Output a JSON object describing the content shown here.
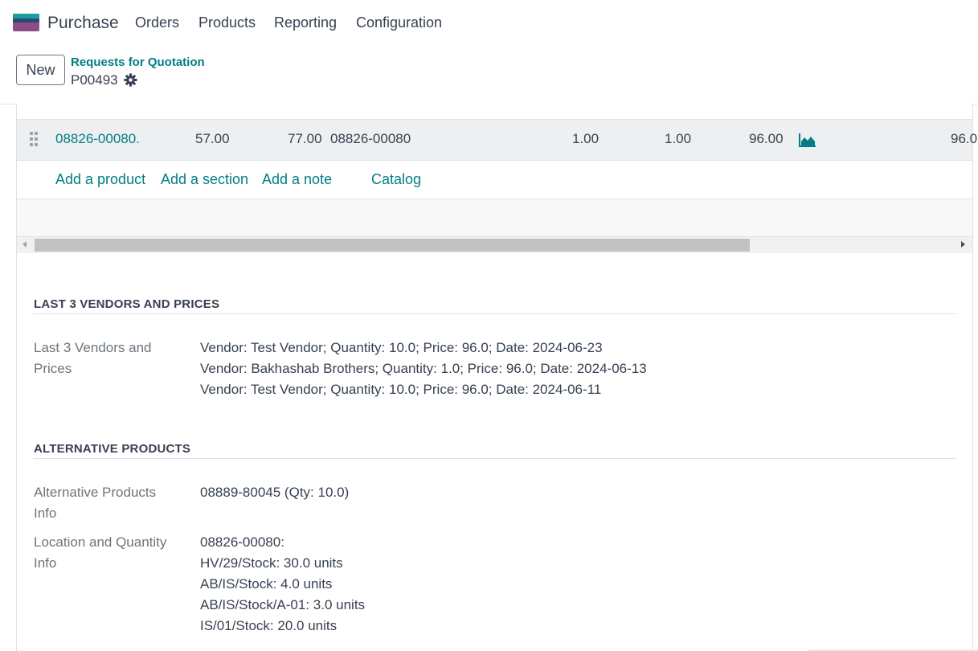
{
  "nav": {
    "app_name": "Purchase",
    "menu": [
      "Orders",
      "Products",
      "Reporting",
      "Configuration"
    ]
  },
  "control_panel": {
    "new_label": "New",
    "breadcrumb_parent": "Requests for Quotation",
    "breadcrumb_current": "P00493"
  },
  "order_line": {
    "product": "08826-00080.",
    "col_a": "57.00",
    "col_b": "77.00",
    "description": "08826-00080",
    "quantity": "1.00",
    "quantity_2": "1.00",
    "unit_price": "96.00",
    "subtotal": "96.0"
  },
  "line_actions": {
    "add_product": "Add a product",
    "add_section": "Add a section",
    "add_note": "Add a note",
    "catalog": "Catalog"
  },
  "vendors_section": {
    "title": "LAST 3 VENDORS AND PRICES",
    "label": "Last 3 Vendors and Prices",
    "lines": [
      "Vendor: Test Vendor; Quantity: 10.0; Price: 96.0; Date: 2024-06-23",
      "Vendor: Bakhashab Brothers; Quantity: 1.0; Price: 96.0; Date: 2024-06-13",
      "Vendor: Test Vendor; Quantity: 10.0; Price: 96.0; Date: 2024-06-11"
    ]
  },
  "alternatives_section": {
    "title": "ALTERNATIVE PRODUCTS",
    "alt_label": "Alternative Products Info",
    "alt_value": "08889-80045 (Qty: 10.0)",
    "loc_label": "Location and Quantity Info",
    "loc_lines": [
      "08826-00080:",
      "HV/29/Stock: 30.0 units",
      "AB/IS/Stock: 4.0 units",
      "AB/IS/Stock/A-01: 3.0 units",
      "IS/01/Stock: 20.0 units"
    ]
  },
  "icons": {
    "logo": "purchase-app-logo",
    "gear": "gear-icon",
    "handle": "drag-handle-icon",
    "forecast": "area-chart-icon"
  },
  "colors": {
    "accent": "#017e84",
    "text": "#374151",
    "muted": "#6c757d"
  }
}
